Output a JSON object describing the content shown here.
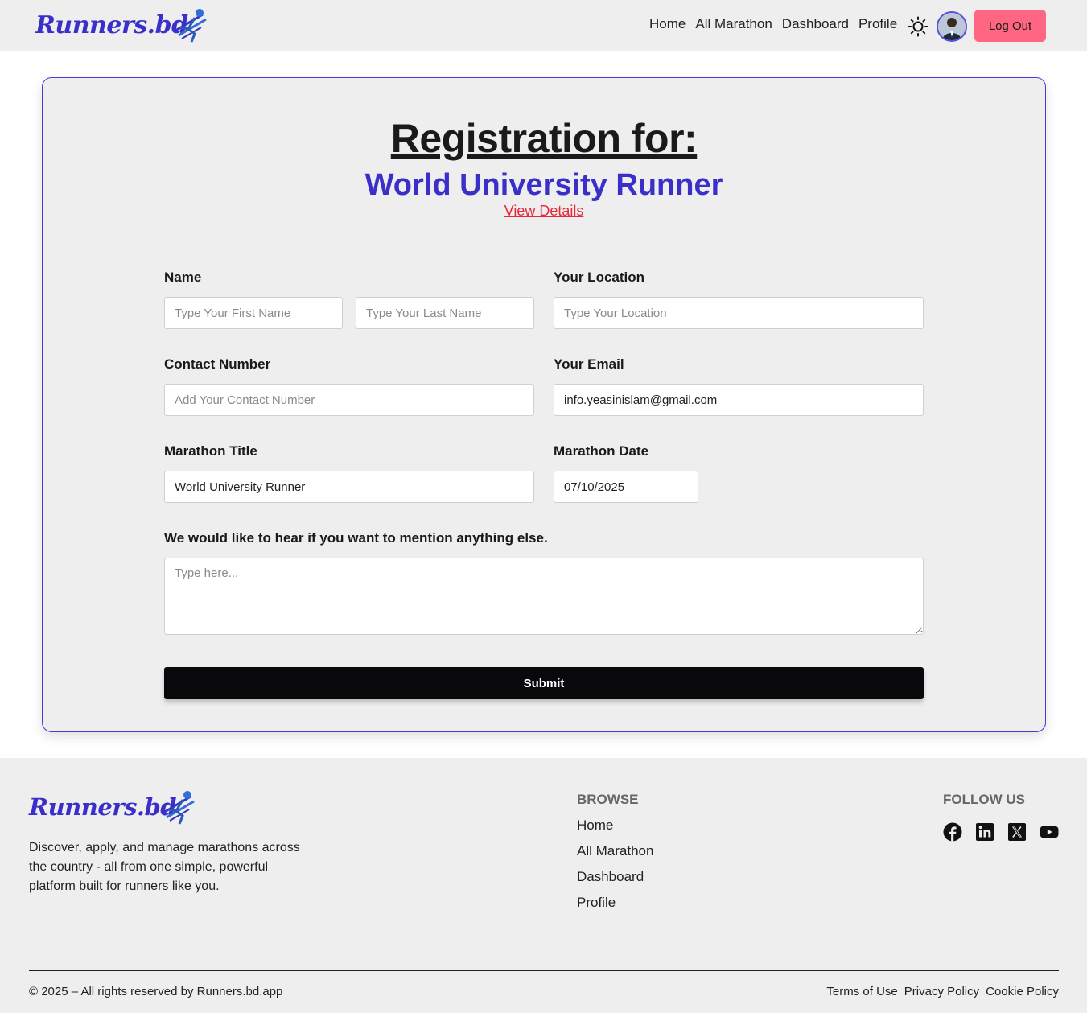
{
  "header": {
    "logo_text": "Runners.bd",
    "nav": [
      {
        "label": "Home"
      },
      {
        "label": "All Marathon"
      },
      {
        "label": "Dashboard"
      },
      {
        "label": "Profile"
      }
    ],
    "logout_label": "Log Out"
  },
  "form": {
    "title": "Registration for:",
    "marathon_name": "World University Runner",
    "view_details": "View Details",
    "name_label": "Name",
    "first_name_placeholder": "Type Your First Name",
    "last_name_placeholder": "Type Your Last Name",
    "location_label": "Your Location",
    "location_placeholder": "Type Your Location",
    "contact_label": "Contact Number",
    "contact_placeholder": "Add Your Contact Number",
    "email_label": "Your Email",
    "email_value": "info.yeasinislam@gmail.com",
    "marathon_title_label": "Marathon Title",
    "marathon_title_value": "World University Runner",
    "marathon_date_label": "Marathon Date",
    "marathon_date_value": "07/10/2025",
    "message_label": "We would like to hear if you want to mention anything else.",
    "message_placeholder": "Type here...",
    "submit_label": "Submit"
  },
  "footer": {
    "logo_text": "Runners.bd",
    "description": "Discover, apply, and manage marathons across the country - all from one simple, powerful platform built for runners like you.",
    "browse_heading": "BROWSE",
    "browse_links": [
      {
        "label": "Home"
      },
      {
        "label": "All Marathon"
      },
      {
        "label": "Dashboard"
      },
      {
        "label": "Profile"
      }
    ],
    "follow_heading": "FOLLOW US",
    "social_icons": [
      "facebook-icon",
      "linkedin-icon",
      "x-icon",
      "youtube-icon"
    ],
    "copyright": "© 2025 – All rights reserved by Runners.bd.app",
    "legal_links": [
      {
        "label": "Terms of Use"
      },
      {
        "label": "Privacy Policy"
      },
      {
        "label": "Cookie Policy"
      }
    ]
  },
  "colors": {
    "brand": "#3b2fc9",
    "logout": "#ff6682",
    "link_red": "#e8273d",
    "submit": "#09090b"
  }
}
